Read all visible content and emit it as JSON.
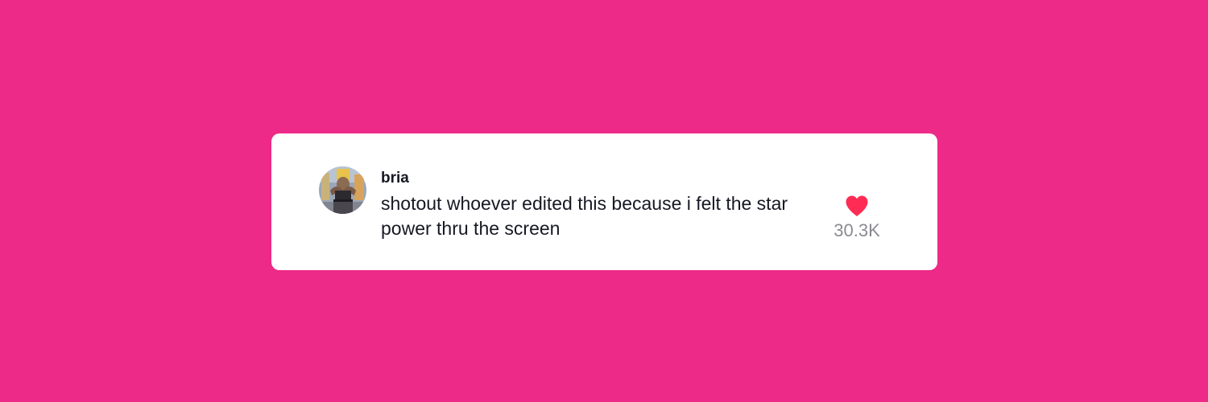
{
  "comment": {
    "username": "bria",
    "text": "shotout whoever edited this because i felt the star power thru the screen",
    "avatar_icon": "user-photo-avatar",
    "likes": {
      "count_label": "30.3K",
      "icon": "heart-icon",
      "icon_color": "#FE2C55"
    }
  },
  "colors": {
    "background": "#ED2A87",
    "card": "#FFFFFF",
    "text": "#161823",
    "muted_text": "#8A8B91"
  }
}
